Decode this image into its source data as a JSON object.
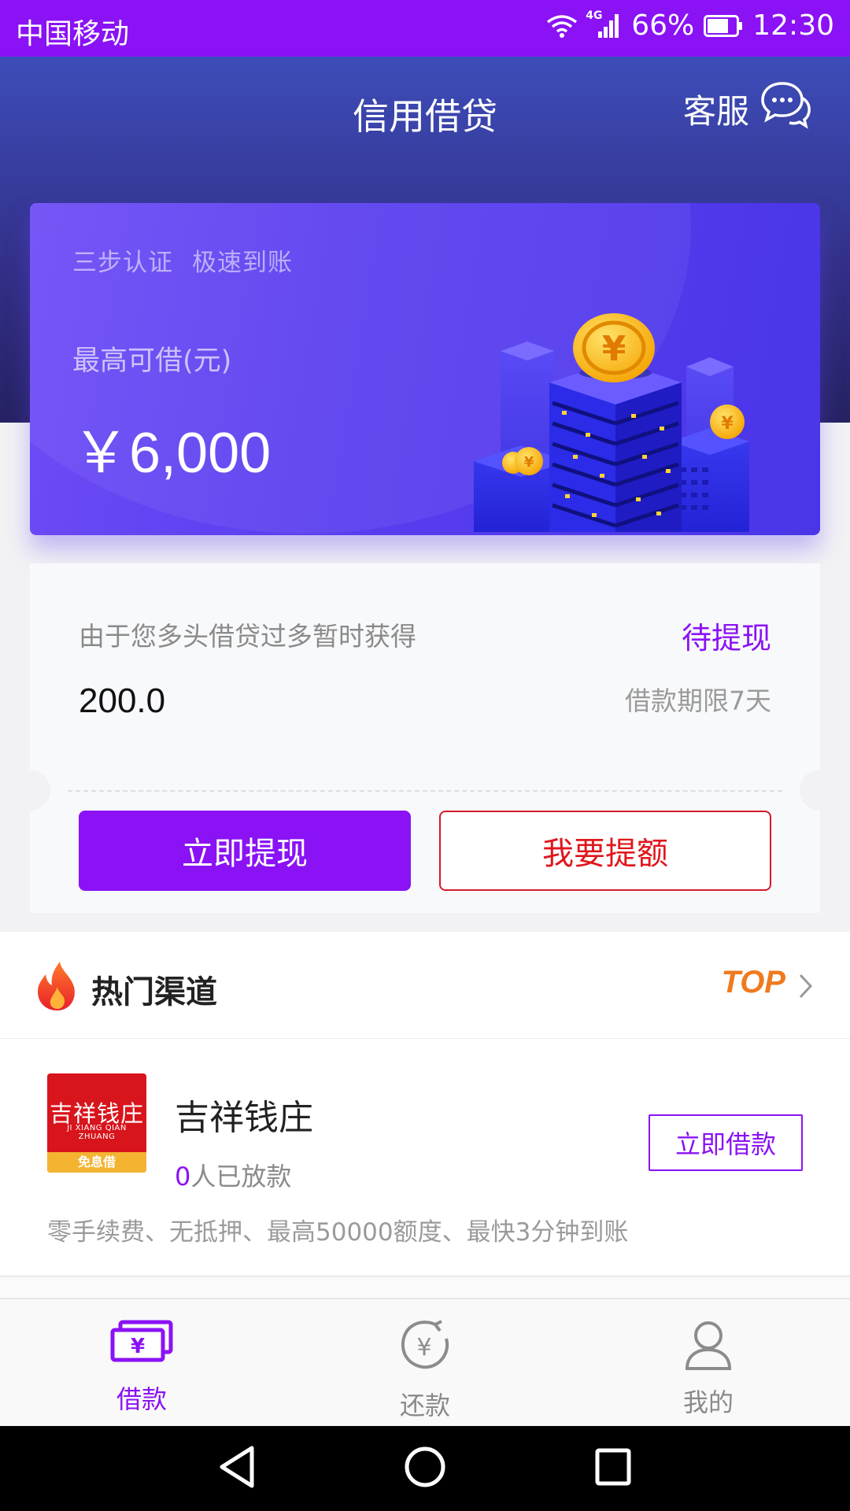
{
  "status_bar": {
    "carrier": "中国移动",
    "network": "4G",
    "battery": "66%",
    "time": "12:30"
  },
  "header": {
    "title": "信用借贷",
    "service_label": "客服"
  },
  "hero": {
    "slogan_1": "三步认证",
    "slogan_2": "极速到账",
    "label": "最高可借(元)",
    "amount": "￥6,000"
  },
  "loan": {
    "reason": "由于您多头借贷过多暂时获得",
    "status": "待提现",
    "value": "200.0",
    "term": "借款期限7天",
    "withdraw_button": "立即提现",
    "raise_button": "我要提额"
  },
  "hot": {
    "title": "热门渠道",
    "top_label": "TOP",
    "item": {
      "logo_text": "吉祥钱庄",
      "logo_pinyin": "JI XIANG QIAN ZHUANG",
      "logo_badge": "免息借",
      "name": "吉祥钱庄",
      "count": "0",
      "count_suffix": "人已放款",
      "button": "立即借款",
      "description": "零手续费、无抵押、最高50000额度、最快3分钟到账"
    }
  },
  "tabs": [
    {
      "label": "借款",
      "icon": "loan-icon",
      "active": true
    },
    {
      "label": "还款",
      "icon": "repay-icon",
      "active": false
    },
    {
      "label": "我的",
      "icon": "user-icon",
      "active": false
    }
  ],
  "colors": {
    "accent": "#8a12f5",
    "danger": "#e0161d",
    "top_orange": "#f07a1e"
  }
}
